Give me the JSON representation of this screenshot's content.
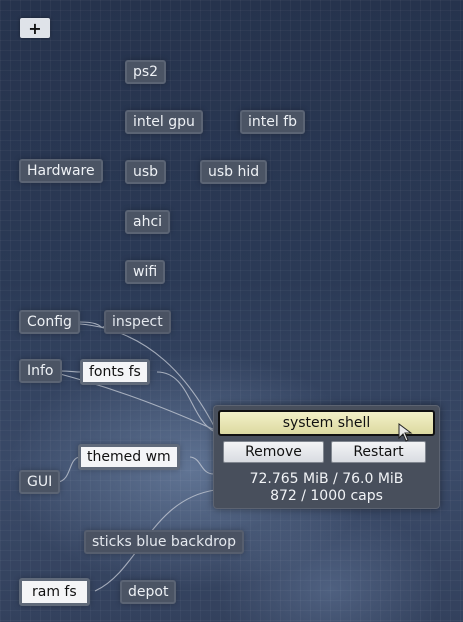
{
  "toolbar": {
    "add_label": "+"
  },
  "nodes": {
    "ps2": "ps2",
    "intel_gpu": "intel gpu",
    "intel_fb": "intel fb",
    "hardware": "Hardware",
    "usb": "usb",
    "usb_hid": "usb hid",
    "ahci": "ahci",
    "wifi": "wifi",
    "config": "Config",
    "inspect": "inspect",
    "info": "Info",
    "fonts_fs": "fonts fs",
    "gui": "GUI",
    "themed_wm": "themed wm",
    "sticks_blue_backdrop": "sticks blue backdrop",
    "ram_fs": "ram fs",
    "depot": "depot"
  },
  "popup": {
    "title": "system shell",
    "remove_label": "Remove",
    "restart_label": "Restart",
    "memory": "72.765 MiB / 76.0 MiB",
    "caps": "872 / 1000 caps"
  },
  "colors": {
    "background": "#2b3a56",
    "node_fill": "#4b5464",
    "highlight_fill": "#f4f5f7",
    "title_fill": "#f3f1c8",
    "wire": "#c9ced8"
  },
  "icons": {
    "cursor": "mouse-pointer-icon"
  }
}
